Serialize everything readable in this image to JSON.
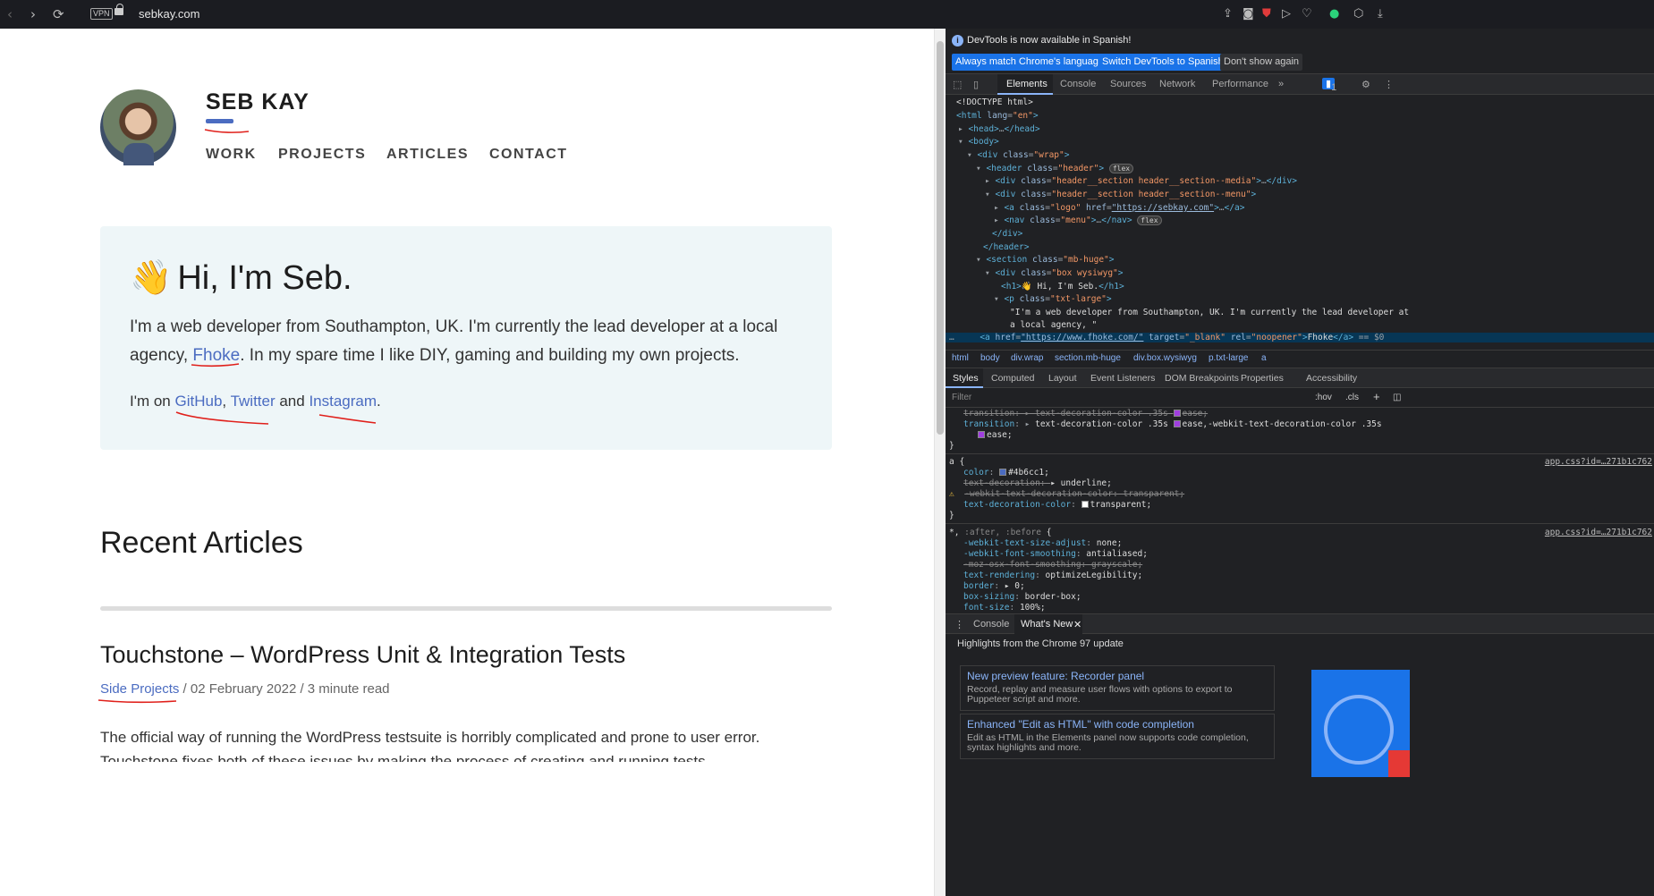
{
  "browser": {
    "url": "sebkay.com",
    "vpn_label": "VPN",
    "back_icon": "‹",
    "forward_icon": "›",
    "reload_icon": "⟳"
  },
  "site": {
    "brand": "SEB KAY",
    "nav": [
      "WORK",
      "PROJECTS",
      "ARTICLES",
      "CONTACT"
    ],
    "hero": {
      "greeting": "Hi, I'm Seb.",
      "wave": "👋",
      "lead_before": "I'm a web developer from Southampton, UK. I'm currently the lead developer at a local agency, ",
      "lead_link": "Fhoke",
      "lead_after": ". In my spare time I like DIY, gaming and building my own projects.",
      "social_prefix": "I'm on ",
      "github": "GitHub",
      "comma": ", ",
      "twitter": "Twitter",
      "and": " and ",
      "instagram": "Instagram",
      "period": "."
    },
    "recent_heading": "Recent Articles",
    "article": {
      "title": "Touchstone – WordPress Unit & Integration Tests",
      "category": "Side Projects",
      "meta": " / 02 February 2022 / 3 minute read",
      "excerpt": "The official way of running the WordPress testsuite is horribly complicated and prone to user error.",
      "excerpt2": "Touchstone fixes both of these issues by making the process of creating and running tests"
    }
  },
  "devtools": {
    "info": "DevTools is now available in Spanish!",
    "btn_match": "Always match Chrome's language",
    "btn_switch": "Switch DevTools to Spanish",
    "btn_dismiss": "Don't show again",
    "tabs": [
      "Elements",
      "Console",
      "Sources",
      "Network",
      "Performance"
    ],
    "more_tabs": "»",
    "issues_count": "1",
    "breadcrumbs": [
      "html",
      "body",
      "div.wrap",
      "section.mb-huge",
      "div.box.wysiwyg",
      "p.txt-large",
      "a"
    ],
    "subtabs": [
      "Styles",
      "Computed",
      "Layout",
      "Event Listeners",
      "DOM Breakpoints",
      "Properties",
      "Accessibility"
    ],
    "filter_placeholder": "Filter",
    "hov": ":hov",
    "cls": ".cls",
    "plus": "+",
    "css_source": "app.css?id=…271b1c762",
    "drawer_tabs": [
      "Console",
      "What's New"
    ],
    "highlights": "Highlights from the Chrome 97 update",
    "cards": [
      {
        "title": "New preview feature: Recorder panel",
        "desc": "Record, replay and measure user flows with options to export to Puppeteer script and more."
      },
      {
        "title": "Enhanced \"Edit as HTML\" with code completion",
        "desc": "Edit as HTML in the Elements panel now supports code completion, syntax highlights and more."
      }
    ],
    "accent": "#4b6cc1"
  }
}
